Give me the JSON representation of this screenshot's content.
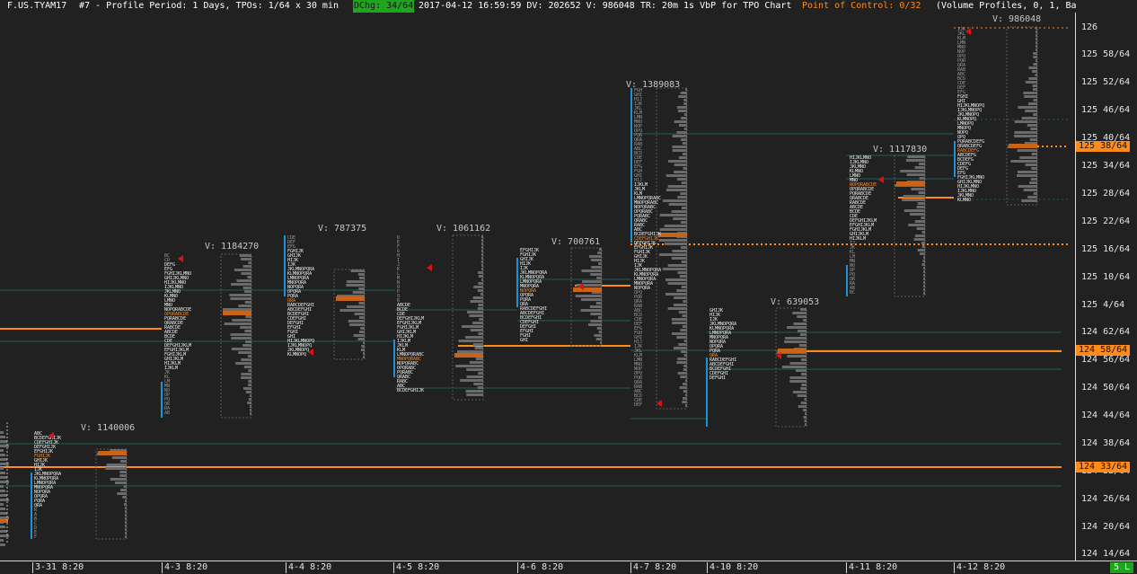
{
  "header": {
    "symbol": "F.US.TYAM17",
    "study": "#7 - Profile Period: 1 Days, TPOs: 1/64 x 30 min",
    "dchg": "DChg: 34/64",
    "stats": "2017-04-12 16:59:59 DV: 202652 V: 986048 TR: 20m 1s VbP for TPO Chart",
    "poc_control": "Point of Control: 0/32",
    "volume_profiles": "(Volume Profiles, 0, 1, Ba"
  },
  "colors": {
    "background": "#212121",
    "poc_orange": "#ff8c1a",
    "value_area_blue": "#1e90d6",
    "teal_line": "#1f5f5a",
    "histogram": "#6b6b6b",
    "marker_red": "#e01010"
  },
  "y_axis": {
    "labels": [
      "126",
      "125 58/64",
      "125 52/64",
      "125 46/64",
      "125 40/64",
      "125 34/64",
      "125 28/64",
      "125 22/64",
      "125 16/64",
      "125 10/64",
      "125 4/64",
      "124 62/64",
      "124 56/64",
      "124 50/64",
      "124 44/64",
      "124 38/64",
      "124 32/64",
      "124 26/64",
      "124 20/64",
      "124 14/64"
    ],
    "price_tags": [
      {
        "label": "125 38/64",
        "color": "#ff8c1a"
      },
      {
        "label": "124 58/64",
        "color": "#ff8c1a"
      },
      {
        "label": "124 33/64",
        "color": "#ff8c1a"
      }
    ]
  },
  "x_axis": {
    "labels": [
      "3-31  8:20",
      "4-3  8:20",
      "4-4  8:20",
      "4-5  8:20",
      "4-6  8:20",
      "4-7  8:20",
      "4-10  8:20",
      "4-11  8:20",
      "4-12  8:20"
    ]
  },
  "profiles": [
    {
      "volume_label": "V: 1140006"
    },
    {
      "volume_label": "V: 1184270"
    },
    {
      "volume_label": "V: 787375"
    },
    {
      "volume_label": "V: 1061162"
    },
    {
      "volume_label": "V: 700761"
    },
    {
      "volume_label": "V: 1389083"
    },
    {
      "volume_label": "V: 639053"
    },
    {
      "volume_label": "V: 1117830"
    },
    {
      "volume_label": "V: 986048"
    }
  ],
  "status_badge": "5 L"
}
